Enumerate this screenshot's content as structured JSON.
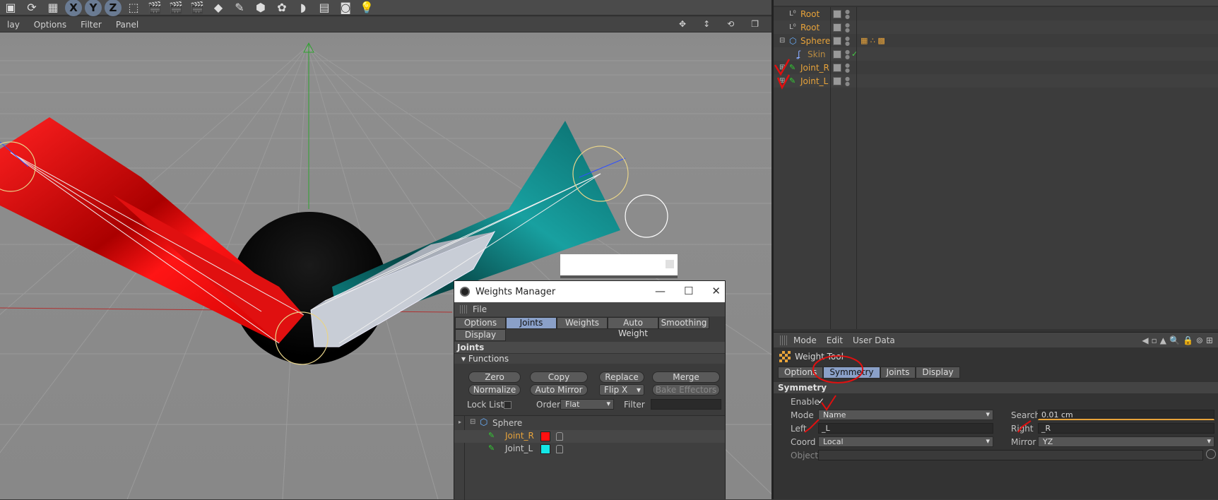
{
  "viewport_menu": [
    "lay",
    "Options",
    "Filter",
    "Panel"
  ],
  "objects": [
    {
      "name": "Root",
      "indent": 1,
      "color": "#e8a33a"
    },
    {
      "name": "Root",
      "indent": 1,
      "color": "#e8a33a"
    },
    {
      "name": "Sphere",
      "indent": 0,
      "color": "#e8a33a"
    },
    {
      "name": "Skin",
      "indent": 2,
      "color": "#c08a3a"
    },
    {
      "name": "Joint_R",
      "indent": 0,
      "color": "#e8a33a"
    },
    {
      "name": "Joint_L",
      "indent": 0,
      "color": "#e8a33a"
    }
  ],
  "attr": {
    "menu": [
      "Mode",
      "Edit",
      "User Data"
    ],
    "title": "Weight Tool",
    "tabs": [
      "Options",
      "Symmetry",
      "Joints",
      "Display"
    ],
    "section": "Symmetry",
    "enable_label": "Enable",
    "enable_check": "✓",
    "mode_label": "Mode",
    "mode_value": "Name",
    "search_label": "Search",
    "search_value": "0.01 cm",
    "left_label": "Left",
    "left_value": "_L",
    "right_label": "Right",
    "right_value": "_R",
    "coord_label": "Coord",
    "coord_value": "Local",
    "mirror_label": "Mirror",
    "mirror_value": "YZ",
    "object_label": "Object"
  },
  "wm": {
    "title": "Weights Manager",
    "menu_file": "File",
    "tabs": [
      "Options",
      "Joints",
      "Weights",
      "Auto Weight",
      "Smoothing",
      "Display"
    ],
    "joints_head": "Joints",
    "functions": "Functions",
    "buttons": [
      "Zero",
      "Copy",
      "Replace",
      "Merge",
      "Normalize",
      "Auto Mirror",
      "Flip X",
      "Bake Effectors"
    ],
    "lock_list": "Lock List",
    "order_label": "Order",
    "order_value": "Flat",
    "filter_label": "Filter",
    "tree": [
      {
        "name": "Sphere",
        "color": "#c8c8c8",
        "swatch": null
      },
      {
        "name": "Joint_R",
        "color": "#e8a33a",
        "swatch": "#ff1010"
      },
      {
        "name": "Joint_L",
        "color": "#c8c8c8",
        "swatch": "#14e6e6"
      }
    ]
  },
  "colors": {
    "accent": "#8aa0c8",
    "red_mesh": "#d41414",
    "teal_mesh": "#0e8a8a",
    "object_name": "#e8a33a"
  }
}
